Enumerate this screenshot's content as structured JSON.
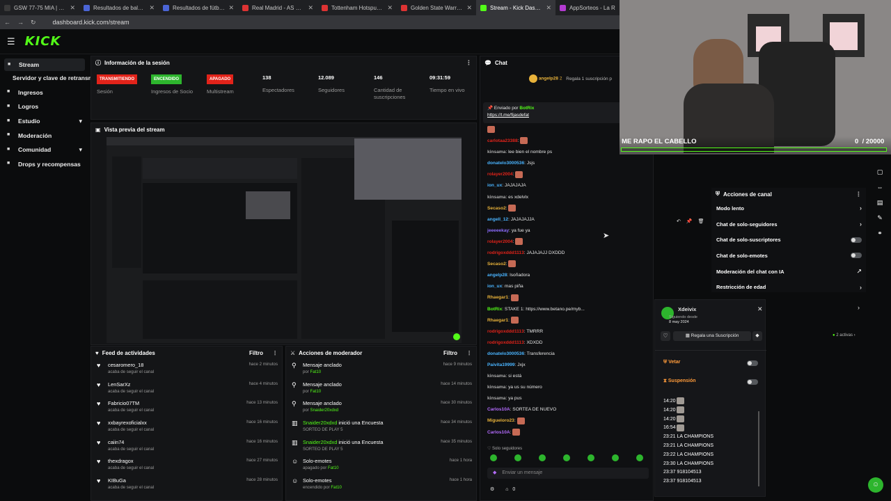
{
  "tabs": [
    {
      "label": "GSW 77-75 MIA | Golden Stat",
      "color": "#3a3a3a"
    },
    {
      "label": "Resultados de baloncesto en",
      "color": "#4b65d6"
    },
    {
      "label": "Resultados de fútbol en direct",
      "color": "#4b65d6"
    },
    {
      "label": "Real Madrid - AS Mónaco Fút",
      "color": "#d33"
    },
    {
      "label": "Tottenham Hotspur - Borussi",
      "color": "#d33"
    },
    {
      "label": "Golden State Warriors - Miam",
      "color": "#d33"
    },
    {
      "label": "Stream - Kick Dashboard",
      "color": "#53fc18"
    },
    {
      "label": "AppSorteos - La R",
      "color": "#b33bd1"
    }
  ],
  "url": "dashboard.kick.com/stream",
  "brand": {
    "logo": "KICK",
    "accent": "#53fc18"
  },
  "sidebar": {
    "items": [
      {
        "label": "Stream",
        "icon": "broadcast-icon",
        "active": true
      },
      {
        "label": "Servidor y clave de retransmisión",
        "sub": true
      },
      {
        "label": "Ingresos",
        "icon": "money-icon"
      },
      {
        "label": "Logros",
        "icon": "trophy-icon"
      },
      {
        "label": "Estudio",
        "icon": "pencil-icon",
        "caret": "▾"
      },
      {
        "label": "Moderación",
        "icon": "sword-icon"
      },
      {
        "label": "Comunidad",
        "icon": "people-icon",
        "caret": "▾"
      },
      {
        "label": "Drops y recompensas",
        "icon": "gift-icon"
      }
    ]
  },
  "session": {
    "title": "Información de la sesión",
    "stats": [
      {
        "badge": "TRANSMITIENDO",
        "badge_color": "#e2231a",
        "label": "Sesión"
      },
      {
        "badge": "ENCENDIDO",
        "badge_color": "#2db52d",
        "label": "Ingresos de Socio"
      },
      {
        "badge": "APAGADO",
        "badge_color": "#e2231a",
        "label": "Multistream"
      },
      {
        "value": "138",
        "label": "Espectadores"
      },
      {
        "value": "12.089",
        "label": "Seguidores"
      },
      {
        "value": "146",
        "label": "Cantidad de suscripciones"
      },
      {
        "value": "09:31:59",
        "label": "Tiempo en vivo"
      }
    ]
  },
  "preview": {
    "title": "Vista previa del stream"
  },
  "feed": {
    "title": "Feed de actividades",
    "filter": "Filtro",
    "items": [
      {
        "name": "cesaromero_18",
        "sub": "acaba de seguir el canal",
        "time": "hace 2 minutos"
      },
      {
        "name": "LenSarXz",
        "sub": "acaba de seguir el canal",
        "time": "hace 4 minutos"
      },
      {
        "name": "Fabricio07TM",
        "sub": "acaba de seguir el canal",
        "time": "hace 13 minutos"
      },
      {
        "name": "xxbayrexoficialxx",
        "sub": "acaba de seguir el canal",
        "time": "hace 16 minutos"
      },
      {
        "name": "caiin74",
        "sub": "acaba de seguir el canal",
        "time": "hace 16 minutos"
      },
      {
        "name": "thexdragox",
        "sub": "acaba de seguir el canal",
        "time": "hace 27 minutos"
      },
      {
        "name": "KIBuGa",
        "sub": "acaba de seguir el canal",
        "time": "hace 28 minutos"
      }
    ]
  },
  "mod": {
    "title": "Acciones de moderador",
    "filter": "Filtro",
    "items": [
      {
        "name": "Mensaje anclado",
        "by": "por",
        "who": "Fat10",
        "time": "hace 9 minutos"
      },
      {
        "name": "Mensaje anclado",
        "by": "por",
        "who": "Fat10",
        "time": "hace 14 minutos"
      },
      {
        "name": "Mensaje anclado",
        "by": "por",
        "who": "Snaider20xdxd",
        "time": "hace 30 minutos"
      },
      {
        "who1": "Snaider20xdxd",
        "name": "inició una Encuesta",
        "sub": "SORTEO DE PLAY 5",
        "time": "hace 34 minutos"
      },
      {
        "who1": "Snaider20xdxd",
        "name": "inició una Encuesta",
        "sub": "SORTEO DE PLAY 5",
        "time": "hace 35 minutos"
      },
      {
        "name": "Solo-emotes",
        "by": "apagado por",
        "who": "Fat10",
        "time": "hace 1 hora"
      },
      {
        "name": "Solo-emotes",
        "by": "encendido por",
        "who": "Fat10",
        "time": "hace 1 hora"
      }
    ]
  },
  "chat": {
    "title": "Chat",
    "top_user": "angelp28",
    "top_count": "2",
    "gift_note": "Regala 1 suscripción p",
    "pinned_by": "Enviado por",
    "pinned_bot": "BotRix",
    "pinned_link": "https://t.me/fijasdefat",
    "lines": [
      {
        "user": "",
        "text": "",
        "color": "#f00",
        "emote": true
      },
      {
        "user": "carlotaa23388",
        "text": "",
        "color": "#e2231a",
        "emote": true
      },
      {
        "user": "kinsama",
        "text": "lee bien el nombre ps",
        "color": "#aaa"
      },
      {
        "user": "donatelo3000536",
        "text": "Jsjs",
        "color": "#4ab4ff"
      },
      {
        "user": "rolayer2004",
        "text": "",
        "color": "#e2231a",
        "emote": true
      },
      {
        "user": "ion_ux",
        "text": "JAJAJAJA",
        "color": "#4ab4ff"
      },
      {
        "user": "kinsama",
        "text": "es xdelvlx",
        "color": "#aaa"
      },
      {
        "user": "Secaso2",
        "text": "",
        "color": "#e8b23a",
        "emote": true
      },
      {
        "user": "angell_12",
        "text": "JAJAJAJJA",
        "color": "#4ab4ff"
      },
      {
        "user": "jeeeeekay",
        "text": "ya fue ya",
        "color": "#8c6cff"
      },
      {
        "user": "rolayer2004",
        "text": "",
        "color": "#e2231a",
        "emote": true
      },
      {
        "user": "rodrigoxddd1113",
        "text": "JAJAJAJJ DXDDD",
        "color": "#e2231a"
      },
      {
        "user": "Secaso2",
        "text": "",
        "color": "#e8b23a",
        "emote": true
      },
      {
        "user": "angelp28",
        "text": "lsoñadora",
        "color": "#4ab4ff"
      },
      {
        "user": "ion_ux",
        "text": "mas piña",
        "color": "#4ab4ff"
      },
      {
        "user": "Rhaegar1",
        "text": "",
        "color": "#e8b23a",
        "emote": true
      },
      {
        "user": "BotRix",
        "text": "STAKE 1: https://www.betano.pe/myb...",
        "color": "#53fc18"
      },
      {
        "user": "Rhaegar1",
        "text": "",
        "color": "#e8b23a",
        "emote": true
      },
      {
        "user": "rodrigoxddd1113",
        "text": "TMRRR",
        "color": "#e2231a"
      },
      {
        "user": "rodrigoxddd1113",
        "text": "XDXDD",
        "color": "#e2231a"
      },
      {
        "user": "donatelo3000536",
        "text": "Transferencia",
        "color": "#4ab4ff"
      },
      {
        "user": "Paivita19999",
        "text": "Jxjx",
        "color": "#4ab4ff"
      },
      {
        "user": "kinsama",
        "text": "si está",
        "color": "#aaa"
      },
      {
        "user": "kinsama",
        "text": "ya us su número",
        "color": "#aaa"
      },
      {
        "user": "kinsama",
        "text": "ya pus",
        "color": "#aaa"
      },
      {
        "user": "Carlos10A",
        "text": "SORTEA DE NUEVO",
        "color": "#b56cff"
      },
      {
        "user": "Migueloro23",
        "text": "",
        "color": "#e8b23a",
        "emote": true
      },
      {
        "user": "Carlos10A",
        "text": "",
        "color": "#b56cff",
        "emote": true
      }
    ],
    "mode": "Solo seguidores",
    "placeholder": "Enviar un mensaje",
    "count": "0"
  },
  "overlay": {
    "caption": "ME RAPO EL CABELLO",
    "progress": "0",
    "goal": "/ 20000"
  },
  "actions": {
    "title": "Acciones de canal",
    "items": [
      {
        "label": "Modo lento",
        "type": "arrow"
      },
      {
        "label": "Chat de solo-seguidores",
        "type": "arrow"
      },
      {
        "label": "Chat de solo-suscriptores",
        "type": "toggle"
      },
      {
        "label": "Chat de solo-emotes",
        "type": "toggle"
      },
      {
        "label": "Moderación del chat con IA",
        "type": "link"
      },
      {
        "label": "Restricción de edad",
        "type": "arrow"
      }
    ],
    "active_count": "2 activas"
  },
  "usercard": {
    "name": "Xdeivix",
    "since_label": "Siguiendo desde",
    "since": "8 may 2024",
    "gift": "Regala una Suscripción",
    "ban": "Vetar",
    "timeout": "Suspensión",
    "log": [
      {
        "time": "14:20",
        "text": ""
      },
      {
        "time": "14:20",
        "text": ""
      },
      {
        "time": "14:20",
        "text": ""
      },
      {
        "time": "16:54",
        "text": ""
      },
      {
        "time": "23:21",
        "text": "LA CHAMPIONS"
      },
      {
        "time": "23:21",
        "text": "LA CHAMPIONS"
      },
      {
        "time": "23:22",
        "text": "LA CHAMPIONS"
      },
      {
        "time": "23:30",
        "text": "LA CHAMPIONS"
      },
      {
        "time": "23:37",
        "text": "918104513"
      },
      {
        "time": "23:37",
        "text": "918104513"
      }
    ]
  }
}
